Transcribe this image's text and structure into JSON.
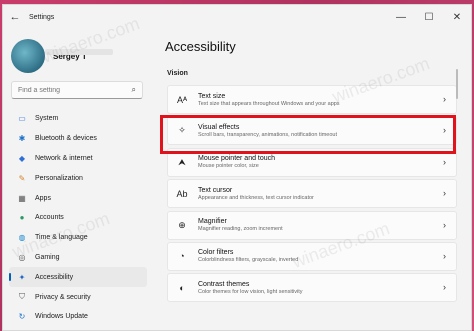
{
  "window": {
    "title": "Settings"
  },
  "titlebar": {
    "back_glyph": "←",
    "minimize": "—",
    "maximize": "☐",
    "close": "✕"
  },
  "user": {
    "name": "Sergey T"
  },
  "search": {
    "placeholder": "Find a setting"
  },
  "sidebar": {
    "items": [
      {
        "label": "System",
        "icon": "system-icon",
        "color": "#3a7bd5"
      },
      {
        "label": "Bluetooth & devices",
        "icon": "bluetooth-icon",
        "color": "#1a73c9"
      },
      {
        "label": "Network & internet",
        "icon": "network-icon",
        "color": "#2f6fd6"
      },
      {
        "label": "Personalization",
        "icon": "brush-icon",
        "color": "#d9822b"
      },
      {
        "label": "Apps",
        "icon": "apps-icon",
        "color": "#5a5a5a"
      },
      {
        "label": "Accounts",
        "icon": "accounts-icon",
        "color": "#2b9a6a"
      },
      {
        "label": "Time & language",
        "icon": "globe-icon",
        "color": "#1a8ad0"
      },
      {
        "label": "Gaming",
        "icon": "gaming-icon",
        "color": "#555"
      },
      {
        "label": "Accessibility",
        "icon": "accessibility-icon",
        "color": "#2466c7"
      },
      {
        "label": "Privacy & security",
        "icon": "shield-icon",
        "color": "#555"
      },
      {
        "label": "Windows Update",
        "icon": "update-icon",
        "color": "#1a73c9"
      }
    ],
    "active_index": 8
  },
  "main": {
    "title": "Accessibility",
    "section": "Vision",
    "cards": [
      {
        "title": "Text size",
        "desc": "Text size that appears throughout Windows and your apps",
        "icon": "text-size-icon",
        "glyph": "Aᴬ"
      },
      {
        "title": "Visual effects",
        "desc": "Scroll bars, transparency, animations, notification timeout",
        "icon": "visual-effects-icon",
        "glyph": "✧"
      },
      {
        "title": "Mouse pointer and touch",
        "desc": "Mouse pointer color, size",
        "icon": "mouse-pointer-icon",
        "glyph": "⮝"
      },
      {
        "title": "Text cursor",
        "desc": "Appearance and thickness, text cursor indicator",
        "icon": "text-cursor-icon",
        "glyph": "Ab"
      },
      {
        "title": "Magnifier",
        "desc": "Magnifier reading, zoom increment",
        "icon": "magnifier-icon",
        "glyph": "⊕"
      },
      {
        "title": "Color filters",
        "desc": "Colorblindness filters, grayscale, inverted",
        "icon": "color-filters-icon",
        "glyph": "◔"
      },
      {
        "title": "Contrast themes",
        "desc": "Color themes for low vision, light sensitivity",
        "icon": "contrast-icon",
        "glyph": "◐"
      }
    ],
    "highlighted_index": 1,
    "highlight_color": "#e0131c"
  },
  "watermark": "winaero.com"
}
